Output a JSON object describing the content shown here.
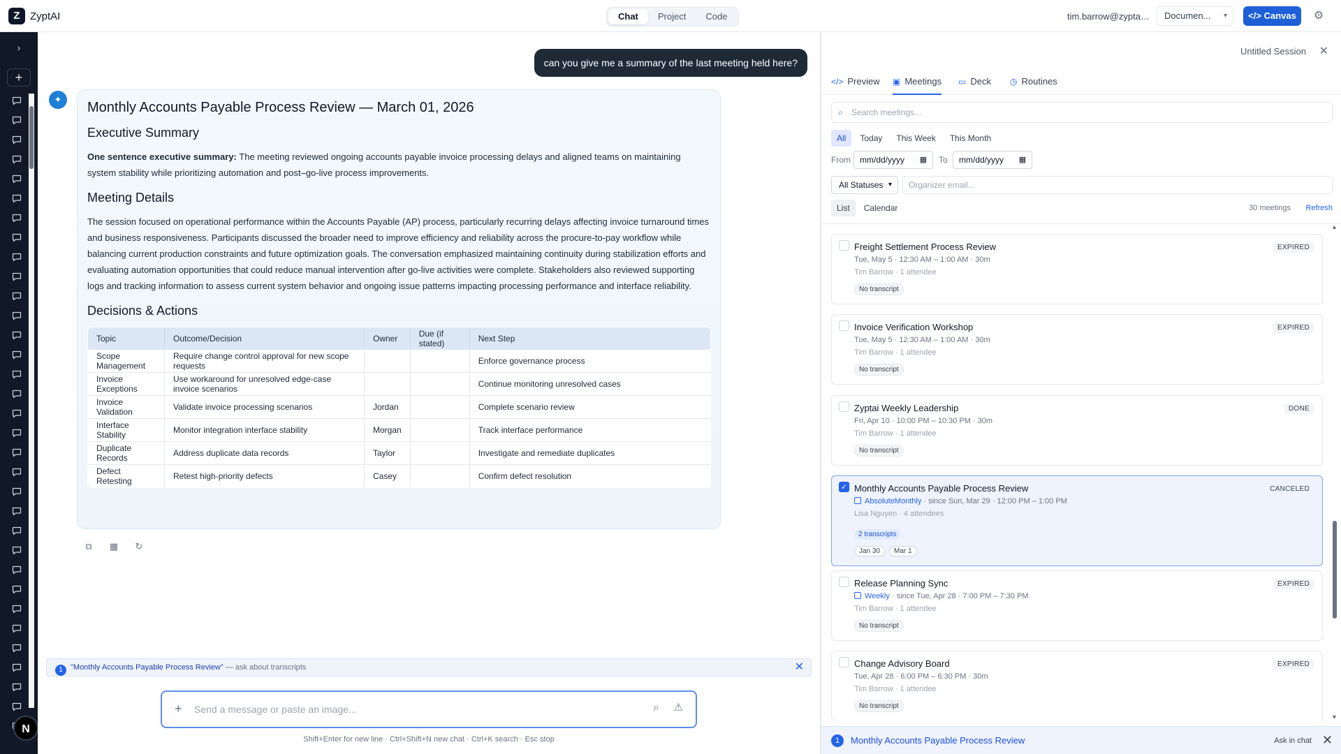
{
  "app": {
    "name": "ZyptAI",
    "logo_letter": "Z",
    "modes": [
      "Chat",
      "Project",
      "Code"
    ],
    "active_mode": "Chat",
    "user_email": "tim.barrow@zyptai.c...",
    "doc_select": "Documen...",
    "canvas_label": "Canvas"
  },
  "sidebar": {
    "badge_letter": "N",
    "chat_items": 33
  },
  "chat": {
    "user_message": "can you give me a summary of the last meeting held here?",
    "answer": {
      "title": "Monthly Accounts Payable Process Review — March 01, 2026",
      "exec_heading": "Executive Summary",
      "exec_label": "One sentence executive summary:",
      "exec_text": " The meeting reviewed ongoing accounts payable invoice processing delays and aligned teams on maintaining system stability while prioritizing automation and post–go-live process improvements.",
      "details_heading": "Meeting Details",
      "details_text": "The session focused on operational performance within the Accounts Payable (AP) process, particularly recurring delays affecting invoice turnaround times and business responsiveness. Participants discussed the broader need to improve efficiency and reliability across the procure-to-pay workflow while balancing current production constraints and future optimization goals. The conversation emphasized maintaining continuity during stabilization efforts and evaluating automation opportunities that could reduce manual intervention after go-live activities were complete. Stakeholders also reviewed supporting logs and tracking information to assess current system behavior and ongoing issue patterns impacting processing performance and interface reliability.",
      "decisions_heading": "Decisions & Actions",
      "table": {
        "headers": [
          "Topic",
          "Outcome/Decision",
          "Owner",
          "Due (if stated)",
          "Next Step"
        ],
        "rows": [
          [
            "Scope Management",
            "Require change control approval for new scope requests",
            "",
            "",
            "Enforce governance process"
          ],
          [
            "Invoice Exceptions",
            "Use workaround for unresolved edge-case invoice scenarios",
            "",
            "",
            "Continue monitoring unresolved cases"
          ],
          [
            "Invoice Validation",
            "Validate invoice processing scenarios",
            "Jordan",
            "",
            "Complete scenario review"
          ],
          [
            "Interface Stability",
            "Monitor integration interface stability",
            "Morgan",
            "",
            "Track interface performance"
          ],
          [
            "Duplicate Records",
            "Address duplicate data records",
            "Taylor",
            "",
            "Investigate and remediate duplicates"
          ],
          [
            "Defect Retesting",
            "Retest high-priority defects",
            "Casey",
            "",
            "Confirm defect resolution"
          ]
        ]
      }
    },
    "context": {
      "count": "1",
      "name": "\"Monthly Accounts Payable Process Review\"",
      "action": " — ask about transcripts"
    },
    "composer_placeholder": "Send a message or paste an image...",
    "hint": "Shift+Enter for new line · Ctrl+Shift+N new chat · Ctrl+K search · Esc stop"
  },
  "panel": {
    "session": "Untitled Session",
    "tabs": [
      "Preview",
      "Meetings",
      "Deck",
      "Routines"
    ],
    "active_tab": "Meetings",
    "search_placeholder": "Search meetings...",
    "filters": [
      "All",
      "Today",
      "This Week",
      "This Month"
    ],
    "from_label": "From",
    "to_label": "To",
    "date_placeholder": "mm/dd/yyyy",
    "status_select": "All Statuses",
    "organizer_placeholder": "Organizer email...",
    "views": [
      "List",
      "Calendar"
    ],
    "count": "30 meetings",
    "refresh": "Refresh",
    "meetings": [
      {
        "title": "Freight Settlement Process Review",
        "status": "EXPIRED",
        "when": "Tue, May 5 · 12:30 AM – 1:00 AM · 30m",
        "who": "Tim Barrow · 1 attendee",
        "transcript": "No transcript"
      },
      {
        "title": "Invoice Verification Workshop",
        "status": "EXPIRED",
        "when": "Tue, May 5 · 12:30 AM – 1:00 AM · 30m",
        "who": "Tim Barrow · 1 attendee",
        "transcript": "No transcript"
      },
      {
        "title": "Zyptai Weekly Leadership",
        "status": "DONE",
        "when": "Fri, Apr 10 · 10:00 PM – 10:30 PM · 30m",
        "who": "Tim Barrow · 1 attendee",
        "transcript": "No transcript"
      },
      {
        "title": "Monthly Accounts Payable Process Review",
        "status": "CANCELED",
        "recurrence": "AbsoluteMonthly",
        "when": " · since Sun, Mar 29 · 12:00 PM – 1:00 PM",
        "who": "Lisa Nguyen · 4 attendees",
        "transcript": "2 transcripts",
        "chips": [
          "Jan 30",
          "Mar 1"
        ]
      },
      {
        "title": "Release Planning Sync",
        "status": "EXPIRED",
        "recurrence": "Weekly",
        "when": " · since Tue, Apr 28 · 7:00 PM – 7:30 PM",
        "who": "Tim Barrow · 1 attendee",
        "transcript": "No transcript"
      },
      {
        "title": "Change Advisory Board",
        "status": "EXPIRED",
        "when": "Tue, Apr 28 · 6:00 PM – 6:30 PM · 30m",
        "who": "Tim Barrow · 1 attendee",
        "transcript": "No transcript"
      }
    ],
    "footer": {
      "count": "1",
      "name": "Monthly Accounts Payable Process Review",
      "ask": "Ask in chat"
    }
  }
}
